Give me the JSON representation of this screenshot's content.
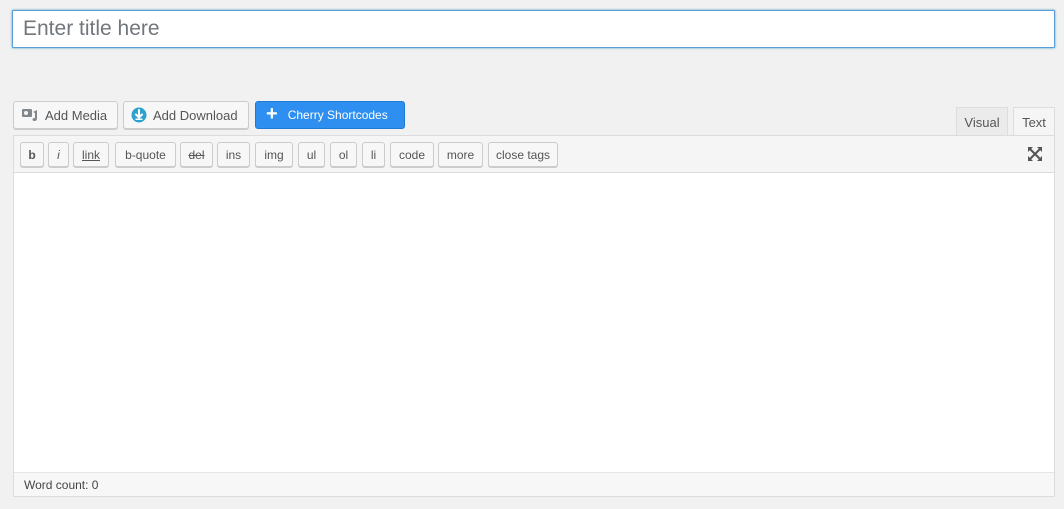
{
  "title_field": {
    "placeholder": "Enter title here",
    "value": ""
  },
  "media_buttons": {
    "add_media": {
      "label": "Add Media",
      "icon": "media-icon"
    },
    "add_download": {
      "label": "Add Download",
      "icon": "download-icon"
    },
    "cherry": {
      "label": "Cherry Shortcodes",
      "icon": "plus-icon"
    }
  },
  "tabs": {
    "visual": "Visual",
    "text": "Text",
    "active": "Text"
  },
  "quicktags": [
    "b",
    "i",
    "link",
    "b-quote",
    "del",
    "ins",
    "img",
    "ul",
    "ol",
    "li",
    "code",
    "more",
    "close tags"
  ],
  "status_bar": {
    "word_count": "Word count: 0"
  },
  "colors": {
    "accent": "#2f8ff0",
    "focus_border": "#5b9dd9"
  }
}
